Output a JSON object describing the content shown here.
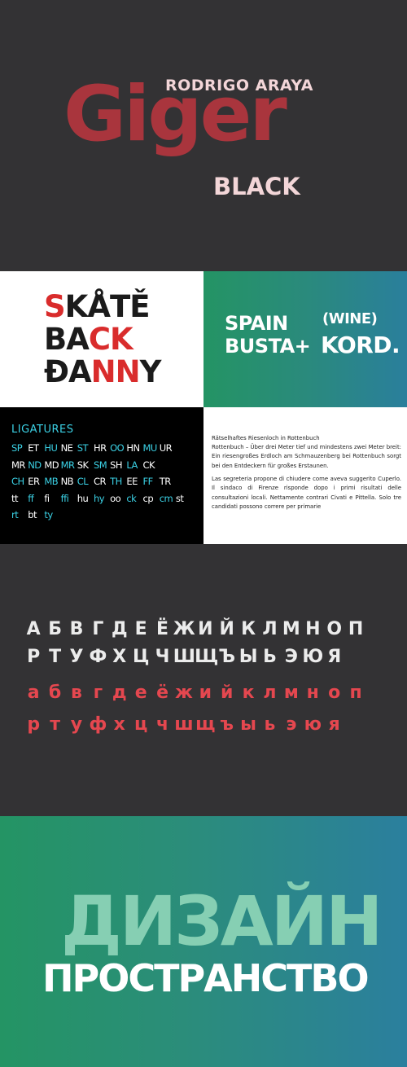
{
  "hero": {
    "author": "RODRIGO ARAYA",
    "title": "Giger",
    "weight": "BLACK"
  },
  "sample_white": {
    "lines": [
      {
        "a": "S",
        "b": "KÅTĚ",
        "c": ""
      },
      {
        "a": "BA",
        "b": "CK",
        "c": ""
      },
      {
        "a": "ĐA",
        "b": "NN",
        "c": "Y"
      }
    ]
  },
  "sample_green": {
    "spain": "SPAIN",
    "busta": "BUSTA+",
    "wine": "(WINE)",
    "kord": "KORD."
  },
  "ligatures": {
    "heading": "LIGATURES",
    "rows": [
      [
        "SP",
        "ET",
        "HU",
        "NE",
        "ST",
        "HR",
        "OO",
        "HN",
        "MU",
        "UR"
      ],
      [
        "MR",
        "ND",
        "MD",
        "MR",
        "SK",
        "SM",
        "SH",
        "LA",
        "CK"
      ],
      [
        "CH",
        "ER",
        "MB",
        "NB",
        "CL",
        "CR",
        "TH",
        "EE",
        "FF",
        "TR"
      ],
      [
        "tt",
        "ff",
        "fi",
        "ffi",
        "hu",
        "hy",
        "oo",
        "ck",
        "cp",
        "cm",
        "st"
      ],
      [
        "rt",
        "bt",
        "ty"
      ]
    ],
    "highlight": [
      [
        0,
        2,
        4,
        6,
        8
      ],
      [
        1,
        3,
        5,
        7
      ],
      [
        0,
        2,
        4,
        6,
        8
      ],
      [
        1,
        3,
        5,
        7,
        9
      ],
      [
        0,
        2
      ]
    ]
  },
  "text_sample": {
    "heading": "Rätselhaftes Riesenloch in Rottenbuch",
    "paragraph1": "Rottenbuch – Über drei Meter tief und mindestens zwei Meter breit: Ein riesengroßes Erdloch am Schmauzenberg bei Rottenbuch sorgt bei den Entdeckern für großes Erstaunen.",
    "paragraph2": "Las segreteria propone di chiudere come aveva suggerito Cuperlo. Il sindaco di Firenze risponde dopo i primi risultati delle consultazioni locali. Nettamente contrari Civati e Pittella. Solo tre candidati possono correre per primarie"
  },
  "cyrillic": {
    "upper1": [
      "А",
      "Б",
      "В",
      "Г",
      "Д",
      "Е",
      "Ё",
      "Ж",
      "И",
      "Й",
      "К",
      "Л",
      "М",
      "Н",
      "О",
      "П"
    ],
    "upper2": [
      "Р",
      "Т",
      "У",
      "Ф",
      "Х",
      "Ц",
      "Ч",
      "Ш",
      "Щ",
      "Ъ",
      "Ы",
      "Ь",
      "Э",
      "Ю",
      "Я"
    ],
    "lower1": [
      "а",
      "б",
      "в",
      "г",
      "д",
      "е",
      "ё",
      "ж",
      "и",
      "й",
      "к",
      "л",
      "м",
      "н",
      "о",
      "п"
    ],
    "lower2": [
      "р",
      "т",
      "у",
      "ф",
      "х",
      "ц",
      "ч",
      "ш",
      "щ",
      "ъ",
      "ы",
      "ь",
      "э",
      "ю",
      "я"
    ]
  },
  "cyr_display": {
    "big": "ДИЗАЙН",
    "sub": "ПРОСТРАНСТВО"
  },
  "colors": {
    "dark_bg": "#333234",
    "title_red": "#a9353d",
    "accent_cyan": "#3bd2e6",
    "cyrillic_pink": "#e5474f"
  }
}
